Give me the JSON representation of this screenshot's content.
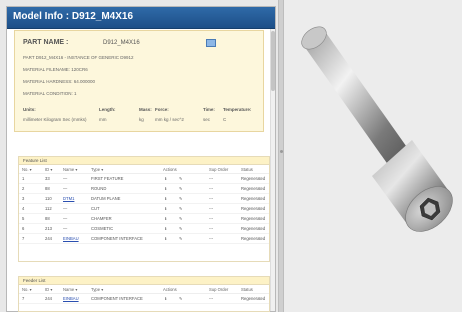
{
  "title": "Model Info : D912_M4X16",
  "info": {
    "part_name_label": "PART NAME :",
    "part_name_value": "D912_M4X16",
    "lines": [
      "PART D912_M4X16 - INSTANCE OF GENERIC D9912",
      "MATERIAL FILENAME: 120CR6",
      "MATERIAL HARDNESS: 64.000000",
      "MATERIAL CONDITION: 1"
    ],
    "units_headers": [
      "Units:",
      "Length:",
      "Mass:",
      "Force:",
      "Time:",
      "Temperature:"
    ],
    "units_values": [
      "millimeter Kilogram Sec (mmks)",
      "mm",
      "kg",
      "mm kg / sec^2",
      "sec",
      "C"
    ]
  },
  "feature_list": {
    "title": "Feature List",
    "headers": [
      "No. ▾",
      "ID ▾",
      "Name ▾",
      "Type ▾",
      "Actions",
      "Sup Order",
      "Status"
    ],
    "rows": [
      {
        "no": "1",
        "id": "33",
        "name": "—",
        "type": "FIRST FEATURE",
        "sup": "---",
        "status": "Regenerated"
      },
      {
        "no": "2",
        "id": "88",
        "name": "—",
        "type": "ROUND",
        "sup": "---",
        "status": "Regenerated"
      },
      {
        "no": "3",
        "id": "110",
        "name": "DTM1",
        "type": "DATUM PLANE",
        "sup": "---",
        "status": "Regenerated"
      },
      {
        "no": "4",
        "id": "112",
        "name": "—",
        "type": "CUT",
        "sup": "---",
        "status": "Regenerated"
      },
      {
        "no": "5",
        "id": "88",
        "name": "—",
        "type": "CHAMFER",
        "sup": "---",
        "status": "Regenerated"
      },
      {
        "no": "6",
        "id": "213",
        "name": "—",
        "type": "COSMETIC",
        "sup": "---",
        "status": "Regenerated"
      },
      {
        "no": "7",
        "id": "244",
        "name": "EINBAU",
        "type": "COMPONENT INTERFACE",
        "sup": "---",
        "status": "Regenerated"
      }
    ]
  },
  "feeder_list": {
    "title": "Feeder List",
    "headers": [
      "No. ▾",
      "ID ▾",
      "Name ▾",
      "Type ▾",
      "Actions",
      "Sup Order",
      "Status"
    ],
    "rows": [
      {
        "no": "7",
        "id": "244",
        "name": "EINBAU",
        "type": "COMPONENT INTERFACE",
        "sup": "---",
        "status": "Regenerated"
      }
    ]
  },
  "icons": {
    "part_icon": "model-icon",
    "action_icons": [
      "info-icon",
      "edit-icon"
    ]
  },
  "colors": {
    "titlebar": "#1d4f88",
    "info_bg": "#fdf7dc",
    "link": "#2a4fb0",
    "viewer_bg": "#ececec"
  }
}
